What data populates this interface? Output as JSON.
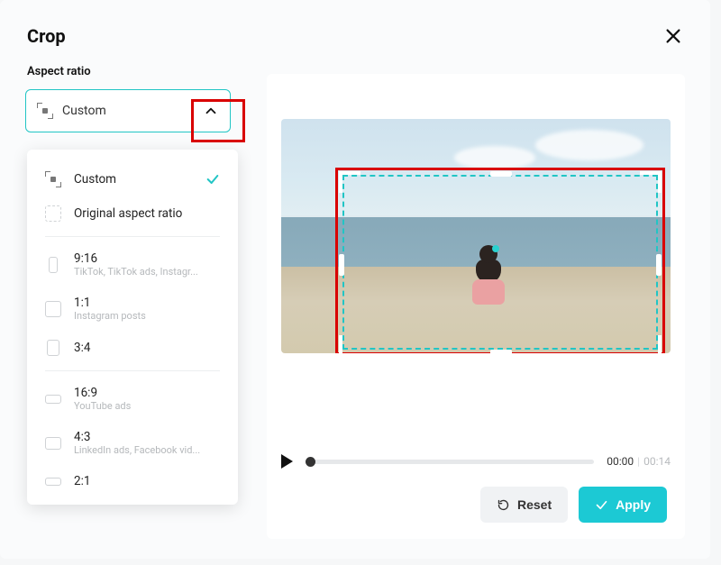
{
  "header": {
    "title": "Crop"
  },
  "section": {
    "aspect_ratio_label": "Aspect ratio"
  },
  "select": {
    "current": "Custom"
  },
  "options": [
    {
      "label": "Custom",
      "sub": "",
      "selected": true,
      "shape": "full"
    },
    {
      "label": "Original aspect ratio",
      "sub": "",
      "selected": false,
      "shape": "dashed-18x18"
    },
    {
      "label": "9:16",
      "sub": "TikTok, TikTok ads, Instagr...",
      "selected": false,
      "shape": "10x18"
    },
    {
      "label": "1:1",
      "sub": "Instagram posts",
      "selected": false,
      "shape": "18x18"
    },
    {
      "label": "3:4",
      "sub": "",
      "selected": false,
      "shape": "14x18"
    },
    {
      "label": "16:9",
      "sub": "YouTube ads",
      "selected": false,
      "shape": "18x10"
    },
    {
      "label": "4:3",
      "sub": "LinkedIn ads, Facebook vid...",
      "selected": false,
      "shape": "18x14"
    },
    {
      "label": "2:1",
      "sub": "",
      "selected": false,
      "shape": "18x9"
    }
  ],
  "player": {
    "current": "00:00",
    "duration": "00:14"
  },
  "actions": {
    "reset": "Reset",
    "apply": "Apply"
  }
}
